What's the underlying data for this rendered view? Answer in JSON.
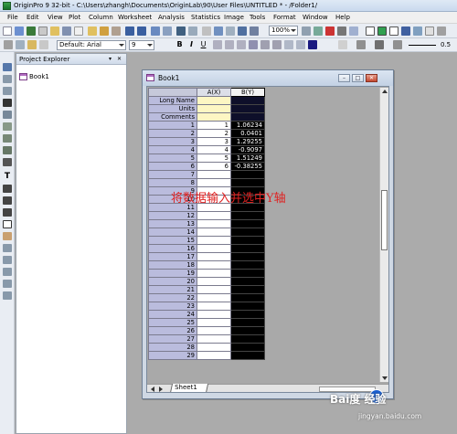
{
  "window_title": "OriginPro 9 32-bit - C:\\Users\\zhangh\\Documents\\OriginLab\\90\\User Files\\UNTITLED * - /Folder1/",
  "menu": [
    "File",
    "Edit",
    "View",
    "Plot",
    "Column",
    "Worksheet",
    "Analysis",
    "Statistics",
    "Image",
    "Tools",
    "Format",
    "Window",
    "Help"
  ],
  "toolbar": {
    "zoom": "100%",
    "font": "Default: Arial",
    "font_size": "9",
    "bold": "B",
    "italic": "I",
    "underline": "U",
    "line_width": "0.5"
  },
  "explorer": {
    "title": "Project Explorer",
    "item": "Book1"
  },
  "book": {
    "title": "Book1",
    "col_a": "A(X)",
    "col_b": "B(Y)",
    "meta_labels": [
      "Long Name",
      "Units",
      "Comments"
    ],
    "row_numbers": [
      "1",
      "2",
      "3",
      "4",
      "5",
      "6",
      "7",
      "8",
      "9",
      "10",
      "11",
      "12",
      "13",
      "14",
      "15",
      "16",
      "17",
      "18",
      "19",
      "20",
      "21",
      "22",
      "23",
      "24",
      "25",
      "26",
      "27",
      "28",
      "29"
    ],
    "a_values": [
      "1",
      "2",
      "3",
      "4",
      "5",
      "6"
    ],
    "b_values": [
      "1.06234",
      "0.0401",
      "1.29255",
      "-0.9097",
      "1.51249",
      "-0.38255"
    ],
    "sheet_tab": "Sheet1"
  },
  "annotation": "将数据输入并选中Y轴",
  "watermark": {
    "brand": "Bai度 经验",
    "url": "jingyan.baidu.com"
  }
}
